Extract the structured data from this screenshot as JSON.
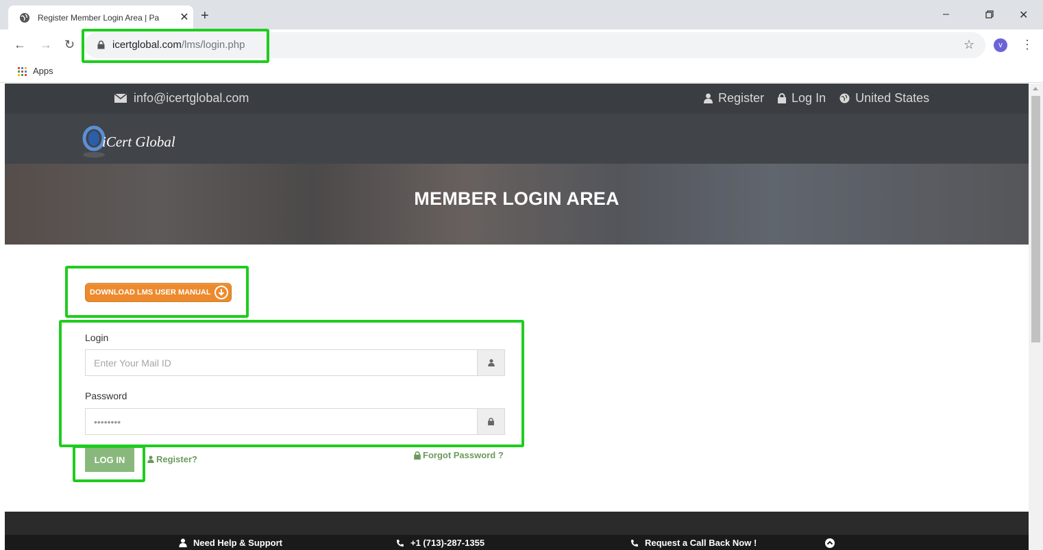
{
  "browser": {
    "tab_title": "Register Member Login Area | Pa",
    "close_label": "✕",
    "new_tab_label": "+",
    "url_host": "icertglobal.com",
    "url_path": "/lms/login.php",
    "profile_initial": "v",
    "bookmarks_apps_label": "Apps"
  },
  "topbar": {
    "email": "info@icertglobal.com",
    "register_label": "Register",
    "login_label": "Log In",
    "country_label": "United States"
  },
  "header": {
    "logo_text": "iCert Global"
  },
  "banner": {
    "title": "MEMBER LOGIN AREA"
  },
  "form": {
    "download_button_label": "DOWNLOAD LMS USER MANUAL",
    "login_label": "Login",
    "login_placeholder": "Enter Your Mail ID",
    "password_label": "Password",
    "password_value": "••••••••",
    "login_button_label": "LOG IN",
    "register_link_label": "Register?",
    "forgot_link_label": "Forgot Password ?"
  },
  "footer": {
    "help_label": "Need Help & Support",
    "phone_label": "+1 (713)-287-1355",
    "callback_label": "Request a Call Back Now !"
  },
  "colors": {
    "highlight": "#1fcc1f",
    "topbar_bg": "#3a3d42",
    "download_orange": "#ec8a2d",
    "login_green": "#89b87c",
    "link_green": "#6b9a5c"
  }
}
